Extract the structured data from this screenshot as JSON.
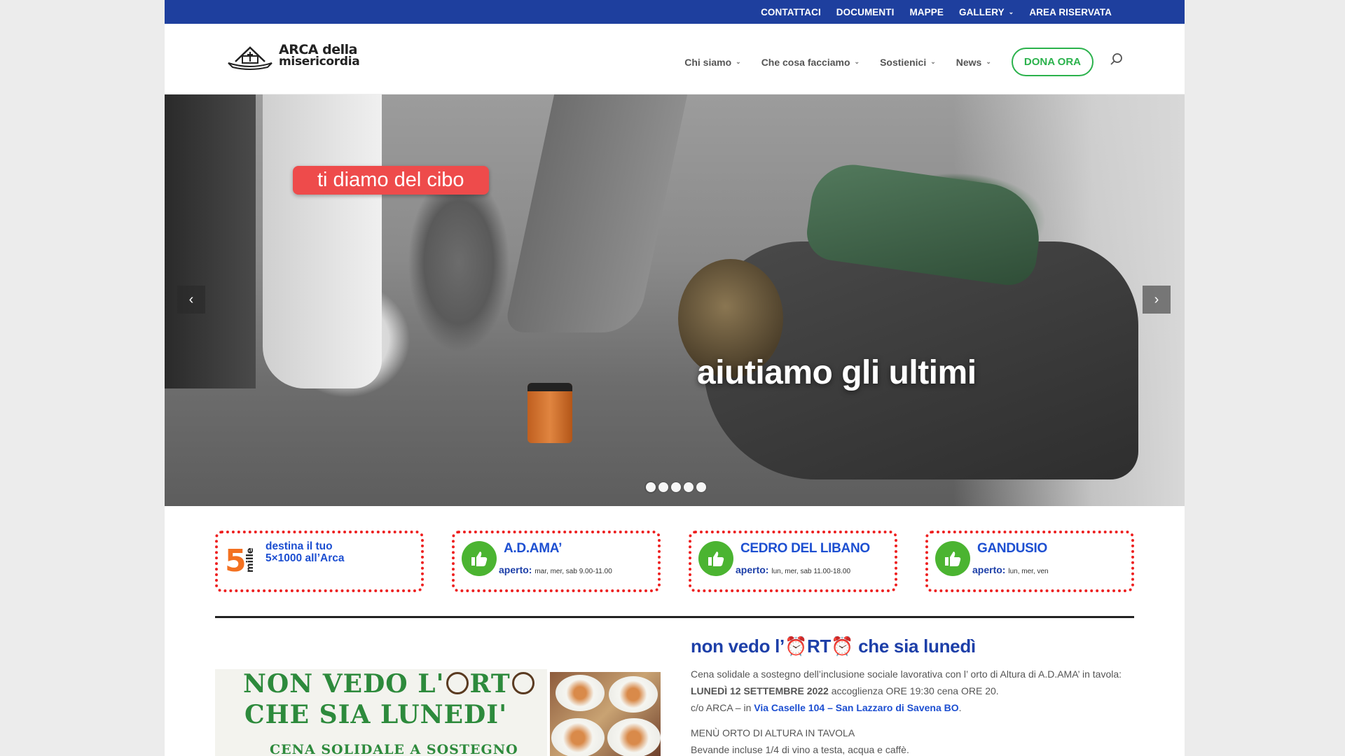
{
  "topbar": {
    "links": [
      "CONTATTACI",
      "DOCUMENTI",
      "MAPPE",
      "GALLERY",
      "AREA RISERVATA"
    ]
  },
  "logo": {
    "line1": "ARCA della",
    "line2": "misericordia"
  },
  "nav": {
    "items": [
      "Chi siamo",
      "Che cosa facciamo",
      "Sostienici",
      "News"
    ],
    "donate": "DONA ORA"
  },
  "hero": {
    "tag": "ti diamo del cibo",
    "caption": "aiutiamo gli ultimi",
    "prev": "‹",
    "next": "›",
    "slides": 5,
    "active_slide": 1
  },
  "boxes": [
    {
      "title_line1": "destina il tuo",
      "title_line2": "5×1000 all’Arca",
      "badge": "5 mille"
    },
    {
      "title": "A.D.AMA’",
      "label": "aperto:",
      "hours": "mar, mer, sab 9.00-11.00"
    },
    {
      "title": "CEDRO DEL LIBANO",
      "label": "aperto:",
      "hours": "lun, mer, sab 11.00-18.00"
    },
    {
      "title": "GANDUSIO",
      "label": "aperto:",
      "hours": "lun, mer, ven"
    }
  ],
  "news": {
    "title_pre": "non vedo l’",
    "title_mid": "RT",
    "title_post": " che sia lunedì",
    "p1": "Cena solidale a sostegno dell’inclusione sociale lavorativa con l’ orto di Altura di A.D.AMA’ in tavola:",
    "p2_bold": "LUNEDÌ 12 SETTEMBRE 2022",
    "p2_rest": " accoglienza ORE 19:30 cena ORE 20.",
    "p3_pre": "c/o ARCA – in ",
    "p3_link": "Via Caselle 104 – San Lazzaro di Savena BO",
    "p3_post": ".",
    "p4": "MENÙ ORTO DI ALTURA IN TAVOLA",
    "p5": "Bevande incluse 1/4 di vino a testa, acqua e caffè."
  },
  "poster": {
    "line1": "NON VEDO L'",
    "line1_tail": "RT",
    "line2": "CHE SIA LUNEDI'",
    "line3": "CENA SOLIDALE A SOSTEGNO"
  },
  "colors": {
    "topbar": "#1e3f9e",
    "accent": "#2bb24c",
    "link": "#1d4fd1",
    "tag": "#ee4b4b",
    "dotted": "#ee2020"
  }
}
